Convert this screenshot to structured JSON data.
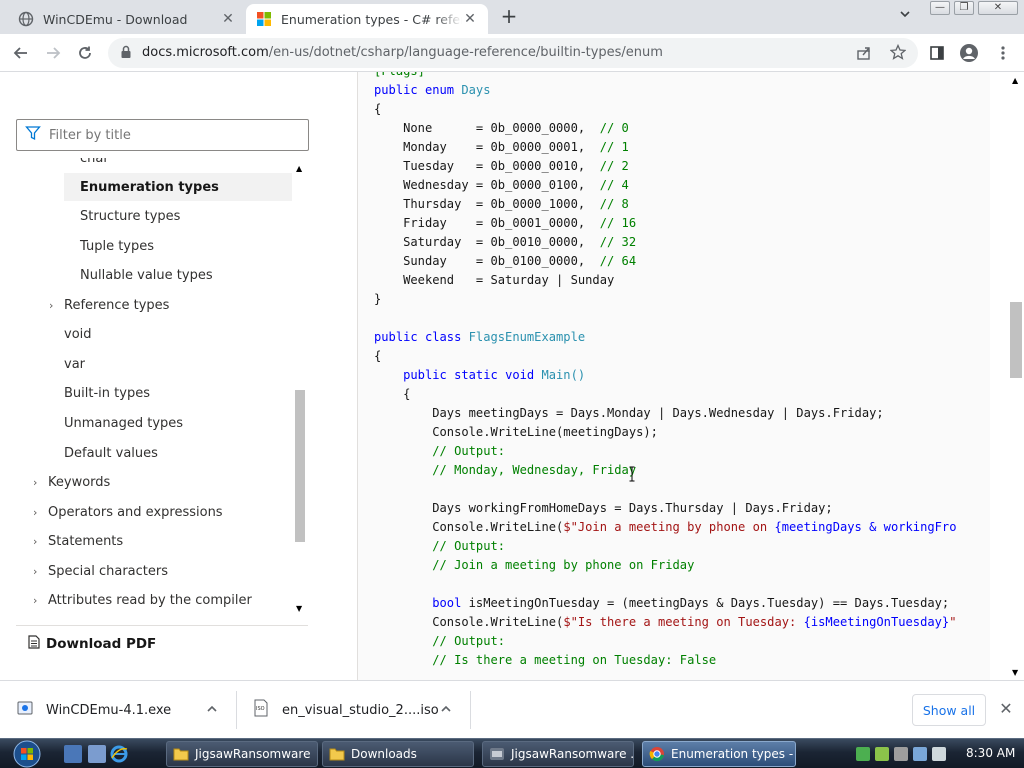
{
  "browser": {
    "tabs": [
      {
        "label": "WinCDEmu - Download",
        "favicon": "globe-icon"
      },
      {
        "label": "Enumeration types - C# reference",
        "favicon": "microsoft-logo-icon"
      }
    ],
    "new_tab": "+",
    "url_domain": "docs.microsoft.com",
    "url_path": "/en-us/dotnet/csharp/language-reference/builtin-types/enum"
  },
  "sidebar": {
    "filter_placeholder": "Filter by title",
    "items": [
      {
        "label": "char",
        "indent": 2
      },
      {
        "label": "Enumeration types",
        "indent": 2,
        "selected": true
      },
      {
        "label": "Structure types",
        "indent": 2
      },
      {
        "label": "Tuple types",
        "indent": 2
      },
      {
        "label": "Nullable value types",
        "indent": 2
      },
      {
        "label": "Reference types",
        "indent": 1,
        "expandable": true
      },
      {
        "label": "void",
        "indent": 1
      },
      {
        "label": "var",
        "indent": 1
      },
      {
        "label": "Built-in types",
        "indent": 1
      },
      {
        "label": "Unmanaged types",
        "indent": 1
      },
      {
        "label": "Default values",
        "indent": 1
      },
      {
        "label": "Keywords",
        "indent": 0,
        "expandable": true
      },
      {
        "label": "Operators and expressions",
        "indent": 0,
        "expandable": true
      },
      {
        "label": "Statements",
        "indent": 0,
        "expandable": true
      },
      {
        "label": "Special characters",
        "indent": 0,
        "expandable": true
      },
      {
        "label": "Attributes read by the compiler",
        "indent": 0,
        "expandable": true
      }
    ],
    "download_pdf": "Download PDF"
  },
  "code": {
    "enum_decl": [
      "public",
      "enum",
      "Days"
    ],
    "members": [
      {
        "name": "None     ",
        "value": "0b_0000_0000",
        "comment": "// 0"
      },
      {
        "name": "Monday   ",
        "value": "0b_0000_0001",
        "comment": "// 1"
      },
      {
        "name": "Tuesday  ",
        "value": "0b_0000_0010",
        "comment": "// 2"
      },
      {
        "name": "Wednesday",
        "value": "0b_0000_0100",
        "comment": "// 4"
      },
      {
        "name": "Thursday ",
        "value": "0b_0000_1000",
        "comment": "// 8"
      },
      {
        "name": "Friday   ",
        "value": "0b_0001_0000",
        "comment": "// 16"
      },
      {
        "name": "Saturday ",
        "value": "0b_0010_0000",
        "comment": "// 32"
      },
      {
        "name": "Sunday   ",
        "value": "0b_0100_0000",
        "comment": "// 64"
      }
    ],
    "weekend": "Weekend   = Saturday | Sunday",
    "class_name": "FlagsEnumExample",
    "main_sig": "Main()",
    "line_meeting": "Days meetingDays = Days.Monday | Days.Wednesday | Days.Friday;",
    "line_writeline1": "Console.WriteLine(meetingDays);",
    "output": "// Output:",
    "out1": "// Monday, Wednesday, Friday",
    "line_working": "Days workingFromHomeDays = Days.Thursday | Days.Friday;",
    "line_writeline2_pre": "Console.WriteLine(",
    "line_writeline2_str": "$\"Join a meeting by phone on ",
    "line_writeline2_expr": "{meetingDays & workingFro",
    "out2": "// Join a meeting by phone on Friday",
    "line_bool": "isMeetingOnTuesday = (meetingDays & Days.Tuesday) == Days.Tuesday;",
    "line_writeline3_str": "$\"Is there a meeting on Tuesday: ",
    "line_writeline3_expr": "{isMeetingOnTuesday}",
    "line_writeline3_end": "\"",
    "out3": "// Is there a meeting on Tuesday: False"
  },
  "downloads": {
    "items": [
      {
        "name": "WinCDEmu-4.1.exe"
      },
      {
        "name": "en_visual_studio_2....iso"
      }
    ],
    "show_all": "Show all"
  },
  "taskbar": {
    "tasks": [
      {
        "label": "JigsawRansomware"
      },
      {
        "label": "Downloads"
      },
      {
        "label": "JigsawRansomware ..."
      },
      {
        "label": "Enumeration types - ..."
      }
    ],
    "clock": "8:30 AM"
  }
}
